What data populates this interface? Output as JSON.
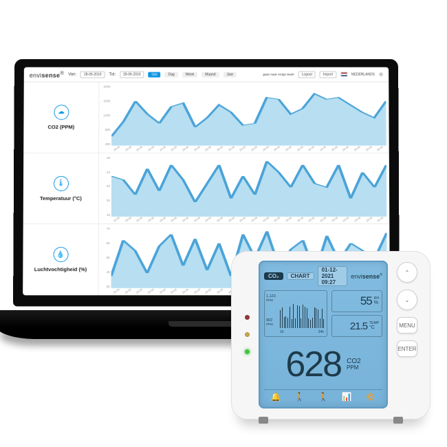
{
  "dashboard": {
    "brand_light": "envi",
    "brand_bold": "sense",
    "brand_reg": "®",
    "from_label": "Van:",
    "to_label": "Tot:",
    "from_value": "28-06-2019",
    "to_value": "28-06-2019",
    "range_selected": "Uur",
    "ranges": [
      "Dag",
      "Week",
      "Maand",
      "Jaar"
    ],
    "status_text": "gaan naar vorige week",
    "logout": "Logout",
    "import": "Import",
    "locale": "NEDERLANDS",
    "rows": [
      {
        "icon": "☁",
        "title": "CO2 (PPM)"
      },
      {
        "icon": "🌡",
        "title": "Temperatuur (°C)"
      },
      {
        "icon": "💧",
        "title": "Luchtvochtigheid (%)"
      }
    ],
    "x_ticks": [
      "28-06",
      "28-06",
      "28-06",
      "28-06",
      "28-06",
      "28-06",
      "28-06",
      "28-06",
      "28-06",
      "28-06",
      "28-06",
      "28-06",
      "28-06",
      "28-06",
      "28-06",
      "28-06",
      "28-06",
      "28-06",
      "28-06",
      "28-06",
      "28-06",
      "28-06",
      "28-06",
      "28-06"
    ]
  },
  "chart_data": [
    {
      "type": "area",
      "title": "CO2 (PPM)",
      "xlabel": "",
      "ylabel": "PPM",
      "ylim": [
        400,
        2000
      ],
      "y_ticks": [
        2000,
        1600,
        1200,
        800,
        400
      ],
      "x_count": 24,
      "values": [
        650,
        1050,
        1600,
        1250,
        1000,
        1450,
        1550,
        900,
        1150,
        1500,
        1300,
        950,
        1000,
        1700,
        1650,
        1250,
        1400,
        1800,
        1650,
        1700,
        1500,
        1300,
        1150,
        1600
      ]
    },
    {
      "type": "area",
      "title": "Temperatuur (°C)",
      "xlabel": "",
      "ylabel": "°C",
      "ylim": [
        18,
        26
      ],
      "y_ticks": [
        26,
        24,
        22,
        20,
        18
      ],
      "x_count": 24,
      "values": [
        23.5,
        23.0,
        21.0,
        24.5,
        21.5,
        25.0,
        23.0,
        20.0,
        22.5,
        25.0,
        20.5,
        23.5,
        21.0,
        25.5,
        24.0,
        22.0,
        25.0,
        22.5,
        22.0,
        25.0,
        20.5,
        24.0,
        22.0,
        25.0
      ]
    },
    {
      "type": "area",
      "title": "Luchtvochtigheid (%)",
      "xlabel": "",
      "ylabel": "%",
      "ylim": [
        30,
        70
      ],
      "y_ticks": [
        70,
        60,
        50,
        40,
        30
      ],
      "x_count": 24,
      "values": [
        38,
        62,
        55,
        40,
        58,
        66,
        45,
        63,
        42,
        60,
        38,
        66,
        50,
        68,
        44,
        56,
        62,
        40,
        65,
        48,
        60,
        55,
        50,
        67
      ]
    }
  ],
  "device": {
    "brand_light": "envi",
    "brand_bold": "sense",
    "brand_reg": "®",
    "tab_co2": "CO₂",
    "tab_chart": "CHART",
    "datetime": "01-12-2021 09:27",
    "rh_value": "55",
    "rh_unit_top": "RH",
    "rh_unit_bot": "%",
    "temp_value": "21.5",
    "temp_unit_top": "TEMP",
    "temp_unit_bot": "°C",
    "co2_value": "628",
    "co2_unit_top": "CO2",
    "co2_unit_bot": "PPM",
    "bar_ylab_top": "1,123",
    "bar_ylab_top2": "PPM",
    "bar_ylab_bot": "902",
    "bar_ylab_bot2": "PPM",
    "bar_min": "1h",
    "bar_max": "24h",
    "bar_values": [
      52,
      60,
      32,
      34,
      30,
      62,
      26,
      70,
      28,
      66,
      64,
      28,
      68,
      62,
      58,
      28,
      24,
      30,
      60,
      58,
      54,
      28,
      56,
      26
    ],
    "buttons": {
      "up": "⌃",
      "down": "⌄",
      "menu": "MENU",
      "enter": "ENTER"
    },
    "bottom_icons": [
      "🔔",
      "🚶",
      "🚶",
      "📊",
      "🔅"
    ]
  }
}
